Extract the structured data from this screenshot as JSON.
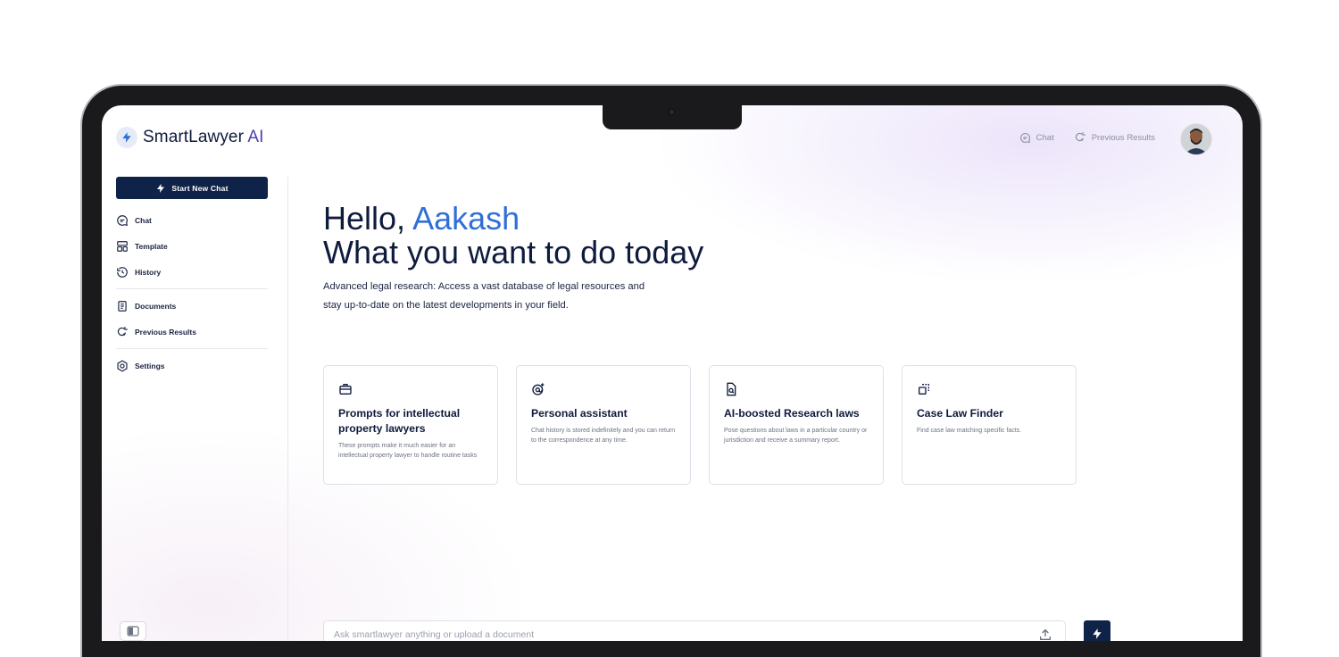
{
  "app": {
    "logo_text": "SmartLawyer",
    "logo_accent": "AI"
  },
  "topnav": {
    "items": [
      {
        "label": "Chat",
        "icon": "chat-icon"
      },
      {
        "label": "Previous Results",
        "icon": "search-refresh-icon"
      }
    ]
  },
  "sidebar": {
    "new_chat_label": "Start New Chat",
    "groups": [
      [
        {
          "label": "Chat",
          "icon": "chat-icon"
        },
        {
          "label": "Template",
          "icon": "template-icon"
        },
        {
          "label": "History",
          "icon": "history-icon"
        }
      ],
      [
        {
          "label": "Documents",
          "icon": "document-icon"
        },
        {
          "label": "Previous Results",
          "icon": "search-refresh-icon"
        }
      ],
      [
        {
          "label": "Settings",
          "icon": "gear-icon"
        }
      ]
    ]
  },
  "main": {
    "greeting_prefix": "Hello,",
    "user_name": "Aakash",
    "headline": "What you want to do today",
    "intro_line1": "Advanced legal research: Access a vast database of legal resources and",
    "intro_line2": "stay up-to-date on the latest developments in your field.",
    "cards": [
      {
        "icon": "briefcase-icon",
        "title": "Prompts for intellectual property lawyers",
        "desc": "These prompts make it much easier for an intellectual property lawyer to handle routine tasks"
      },
      {
        "icon": "user-at-icon",
        "title": "Personal assistant",
        "desc": "Chat history is stored indefinitely and you can return to the correspondence at any time."
      },
      {
        "icon": "document-search-icon",
        "title": "AI-boosted Research laws",
        "desc": "Pose questions about laws in a particular country or jurisdiction and receive a summary report."
      },
      {
        "icon": "copy-icon",
        "title": "Case Law Finder",
        "desc": "Find case law matching specific facts."
      }
    ]
  },
  "composer": {
    "placeholder": "Ask smartlawyer anything or upload a document"
  },
  "colors": {
    "primary": "#0f2248",
    "accent_name": "#2f6fd6",
    "logo_accent": "#4a3fb0"
  }
}
